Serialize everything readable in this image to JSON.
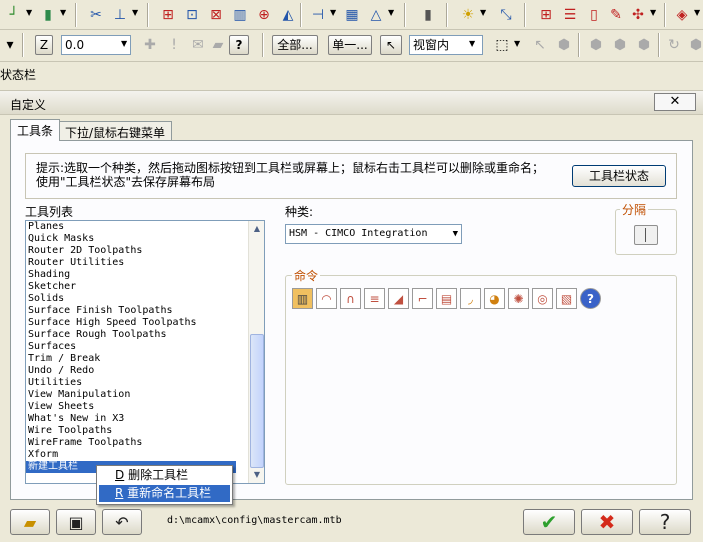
{
  "top_toolbar": {
    "z_label": "Z",
    "z_value": "0.0",
    "all_button": "全部...",
    "single_button": "单一...",
    "view_select": "视窗内"
  },
  "statusbar_label": "状态栏",
  "dialog": {
    "title": "自定义",
    "close_symbol": "✕",
    "tabs": [
      "工具条",
      "下拉/鼠标右键菜单"
    ],
    "hint": "提示:选取一个种类，然后拖动图标按钮到工具栏或屏幕上；鼠标右击工具栏可以删除或重命名；使用\"工具栏状态\"去保存屏幕布局",
    "toolbar_state_button": "工具栏状态",
    "list_label": "工具列表",
    "toolbar_list": [
      "Planes",
      "Quick Masks",
      "Router 2D Toolpaths",
      "Router Utilities",
      "Shading",
      "Sketcher",
      "Solids",
      "Surface Finish Toolpaths",
      "Surface High Speed Toolpaths",
      "Surface Rough Toolpaths",
      "Surfaces",
      "Trim / Break",
      "Undo / Redo",
      "Utilities",
      "View Manipulation",
      "View Sheets",
      "What's New in X3",
      "Wire Toolpaths",
      "WireFrame Toolpaths",
      "Xform",
      "新建工具栏"
    ],
    "selected_item": "新建工具栏",
    "category_label": "种类:",
    "category_value": "HSM - CIMCO Integration",
    "separator_label": "分隔",
    "commands_label": "命令",
    "context_menu": [
      {
        "key": "D",
        "label": "删除工具栏"
      },
      {
        "key": "R",
        "label": "重新命名工具栏"
      }
    ],
    "path": "d:\\mcamx\\config\\mastercam.mtb"
  },
  "colors": {
    "selection": "#316ac5",
    "group_label": "#c04f00",
    "ok_green": "#2ea02e",
    "cancel_red": "#d42a1a"
  }
}
